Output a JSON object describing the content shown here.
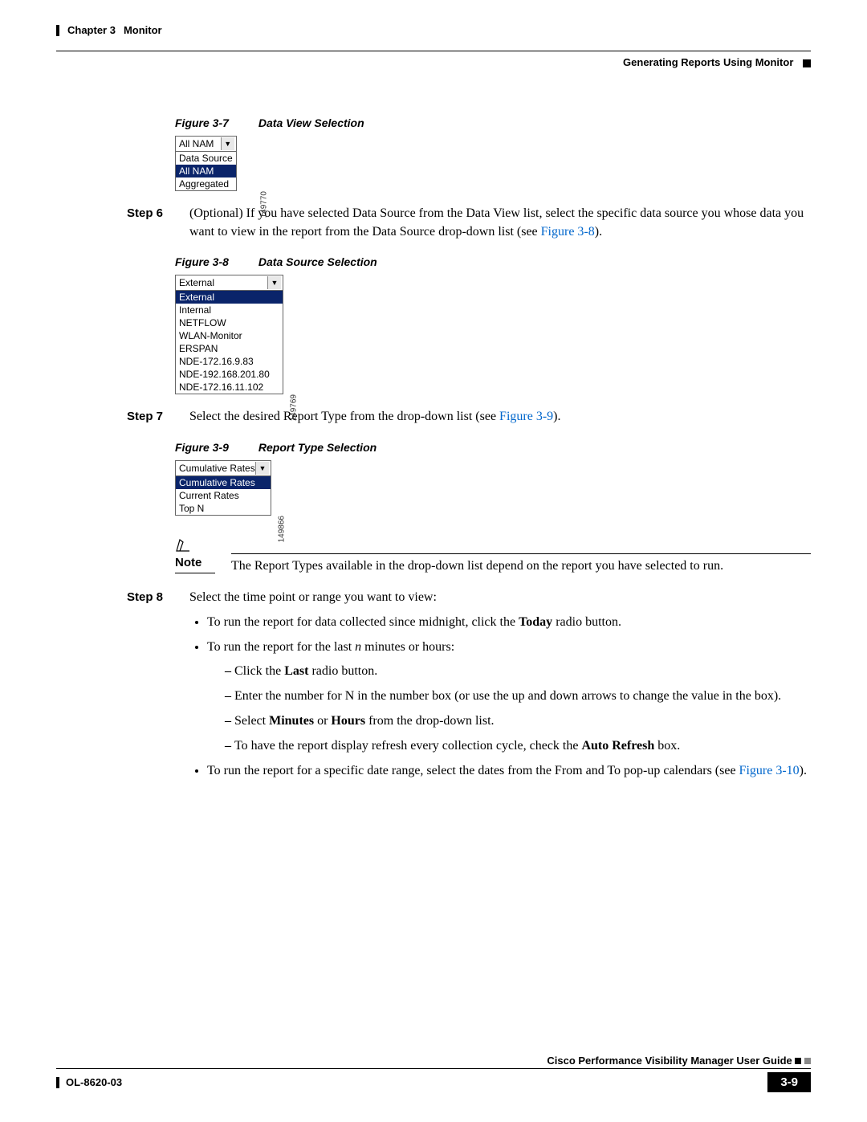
{
  "header": {
    "chapter": "Chapter 3",
    "title": "Monitor",
    "section": "Generating Reports Using Monitor"
  },
  "fig7": {
    "num": "Figure 3-7",
    "title": "Data View Selection",
    "selected": "All NAM",
    "options": [
      "Data Source",
      "All NAM",
      "Aggregated"
    ],
    "selectedIndex": 1,
    "code": "149770"
  },
  "step6": {
    "label": "Step 6",
    "text_a": "(Optional) If you have selected Data Source from the Data View list, select the specific data source you whose data you want to view in the report from the Data Source drop-down list (see ",
    "link": "Figure 3-8",
    "text_b": ")."
  },
  "fig8": {
    "num": "Figure 3-8",
    "title": "Data Source Selection",
    "selected": "External",
    "options": [
      "External",
      "Internal",
      "NETFLOW",
      "WLAN-Monitor",
      "ERSPAN",
      "NDE-172.16.9.83",
      "NDE-192.168.201.80",
      "NDE-172.16.11.102"
    ],
    "selectedIndex": 0,
    "code": "149769"
  },
  "step7": {
    "label": "Step 7",
    "text_a": "Select the desired Report Type from the drop-down list (see ",
    "link": "Figure 3-9",
    "text_b": ")."
  },
  "fig9": {
    "num": "Figure 3-9",
    "title": "Report Type Selection",
    "selected": "Cumulative Rates",
    "options": [
      "Cumulative Rates",
      "Current Rates",
      "Top N"
    ],
    "selectedIndex": 0,
    "code": "149866"
  },
  "note": {
    "label": "Note",
    "text": "The Report Types available in the drop-down list depend on the report you have selected to run."
  },
  "step8": {
    "label": "Step 8",
    "intro": "Select the time point or range you want to view:",
    "b1_a": "To run the report for data collected since midnight, click the ",
    "b1_bold": "Today",
    "b1_b": " radio button.",
    "b2_a": "To run the report for the last ",
    "b2_ital": "n",
    "b2_b": " minutes or hours:",
    "d1_a": "Click the ",
    "d1_bold": "Last",
    "d1_b": " radio button.",
    "d2": "Enter the number for N in the number box (or use the up and down arrows to change the value in the box).",
    "d3_a": "Select ",
    "d3_bold1": "Minutes",
    "d3_mid": " or ",
    "d3_bold2": "Hours",
    "d3_b": " from the drop-down list.",
    "d4_a": "To have the report display refresh every collection cycle, check the ",
    "d4_bold": "Auto Refresh",
    "d4_b": " box.",
    "b3_a": "To run the report for a specific date range, select the dates from the From and To pop-up calendars (see ",
    "b3_link": "Figure 3-10",
    "b3_b": ")."
  },
  "footer": {
    "guide": "Cisco Performance Visibility Manager User Guide",
    "doc": "OL-8620-03",
    "page": "3-9"
  }
}
